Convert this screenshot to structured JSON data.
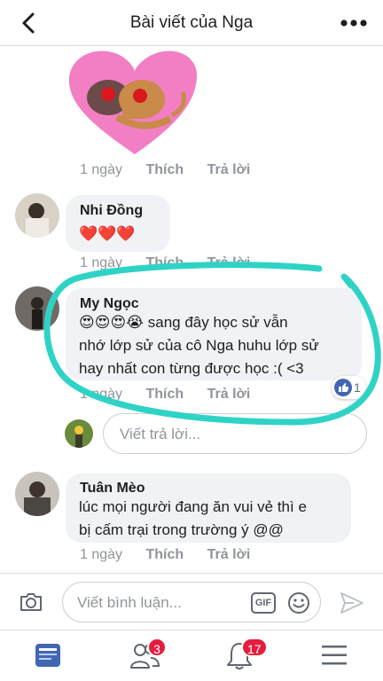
{
  "header": {
    "title": "Bài viết của Nga"
  },
  "sticker_comment": {
    "time": "1 ngày",
    "like": "Thích",
    "reply": "Trả lời"
  },
  "comments": [
    {
      "name": "Nhi Đồng",
      "text": "❤️❤️❤️",
      "time": "1 ngày",
      "like": "Thích",
      "reply": "Trả lời"
    },
    {
      "name": "My Ngọc",
      "line1": "😍😍😍😭 sang đây học sử vẫn",
      "line2": "nhớ lớp sử của cô Nga huhu lớp sử",
      "line3": "hay nhất con từng được học :( <3",
      "time": "1 ngày",
      "like": "Thích",
      "reply": "Trả lời",
      "reaction_count": "1"
    },
    {
      "name": "Tuân Mèo",
      "line1": "lúc mọi người đang ăn vui vẻ thì e",
      "line2": "bị cấm trại trong trường ý @@",
      "time": "1 ngày",
      "like": "Thích",
      "reply": "Trả lời"
    }
  ],
  "reply_input": {
    "placeholder": "Viết trả lời..."
  },
  "composer": {
    "placeholder": "Viết bình luận...",
    "gif_label": "GIF"
  },
  "tabbar": {
    "friend_badge": "3",
    "notif_badge": "17"
  },
  "colors": {
    "accent": "#4267b2",
    "highlight": "#2fd3c6",
    "badge": "#e41e3f"
  }
}
